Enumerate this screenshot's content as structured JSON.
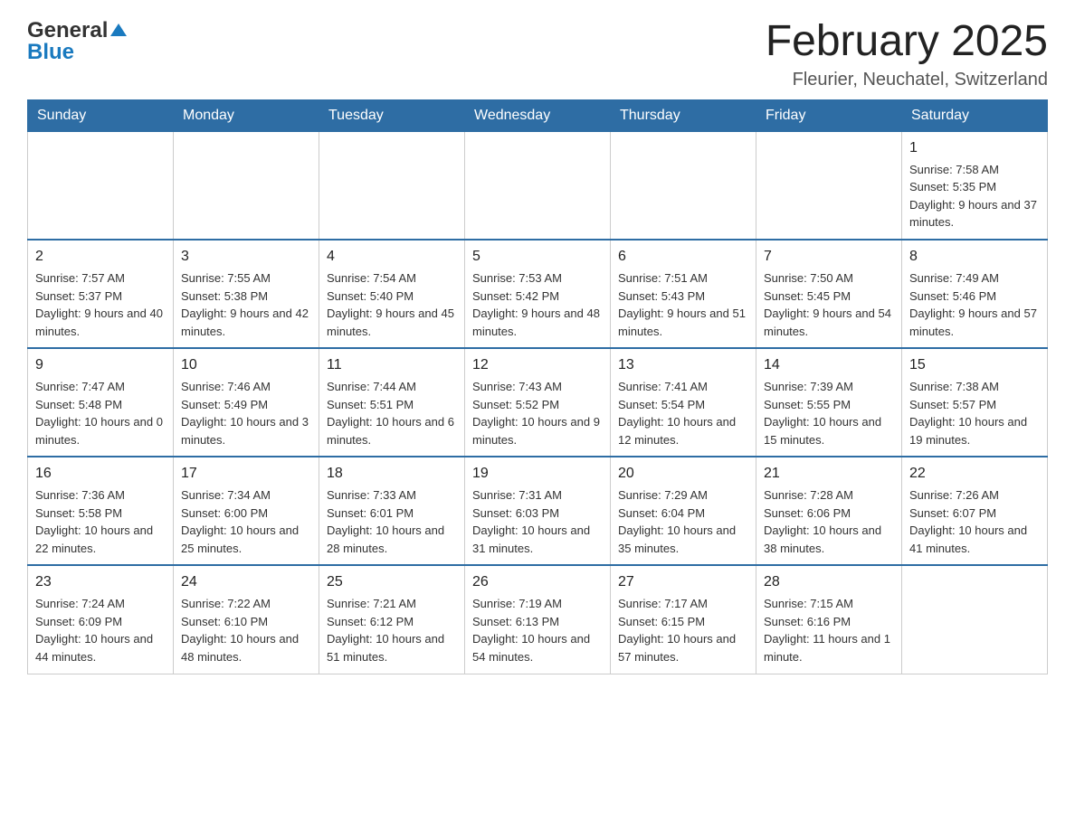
{
  "header": {
    "logo_general": "General",
    "logo_triangle": "▲",
    "logo_blue": "Blue",
    "month_title": "February 2025",
    "location": "Fleurier, Neuchatel, Switzerland"
  },
  "days_of_week": [
    "Sunday",
    "Monday",
    "Tuesday",
    "Wednesday",
    "Thursday",
    "Friday",
    "Saturday"
  ],
  "weeks": [
    [
      {
        "day": "",
        "info": ""
      },
      {
        "day": "",
        "info": ""
      },
      {
        "day": "",
        "info": ""
      },
      {
        "day": "",
        "info": ""
      },
      {
        "day": "",
        "info": ""
      },
      {
        "day": "",
        "info": ""
      },
      {
        "day": "1",
        "info": "Sunrise: 7:58 AM\nSunset: 5:35 PM\nDaylight: 9 hours and 37 minutes."
      }
    ],
    [
      {
        "day": "2",
        "info": "Sunrise: 7:57 AM\nSunset: 5:37 PM\nDaylight: 9 hours and 40 minutes."
      },
      {
        "day": "3",
        "info": "Sunrise: 7:55 AM\nSunset: 5:38 PM\nDaylight: 9 hours and 42 minutes."
      },
      {
        "day": "4",
        "info": "Sunrise: 7:54 AM\nSunset: 5:40 PM\nDaylight: 9 hours and 45 minutes."
      },
      {
        "day": "5",
        "info": "Sunrise: 7:53 AM\nSunset: 5:42 PM\nDaylight: 9 hours and 48 minutes."
      },
      {
        "day": "6",
        "info": "Sunrise: 7:51 AM\nSunset: 5:43 PM\nDaylight: 9 hours and 51 minutes."
      },
      {
        "day": "7",
        "info": "Sunrise: 7:50 AM\nSunset: 5:45 PM\nDaylight: 9 hours and 54 minutes."
      },
      {
        "day": "8",
        "info": "Sunrise: 7:49 AM\nSunset: 5:46 PM\nDaylight: 9 hours and 57 minutes."
      }
    ],
    [
      {
        "day": "9",
        "info": "Sunrise: 7:47 AM\nSunset: 5:48 PM\nDaylight: 10 hours and 0 minutes."
      },
      {
        "day": "10",
        "info": "Sunrise: 7:46 AM\nSunset: 5:49 PM\nDaylight: 10 hours and 3 minutes."
      },
      {
        "day": "11",
        "info": "Sunrise: 7:44 AM\nSunset: 5:51 PM\nDaylight: 10 hours and 6 minutes."
      },
      {
        "day": "12",
        "info": "Sunrise: 7:43 AM\nSunset: 5:52 PM\nDaylight: 10 hours and 9 minutes."
      },
      {
        "day": "13",
        "info": "Sunrise: 7:41 AM\nSunset: 5:54 PM\nDaylight: 10 hours and 12 minutes."
      },
      {
        "day": "14",
        "info": "Sunrise: 7:39 AM\nSunset: 5:55 PM\nDaylight: 10 hours and 15 minutes."
      },
      {
        "day": "15",
        "info": "Sunrise: 7:38 AM\nSunset: 5:57 PM\nDaylight: 10 hours and 19 minutes."
      }
    ],
    [
      {
        "day": "16",
        "info": "Sunrise: 7:36 AM\nSunset: 5:58 PM\nDaylight: 10 hours and 22 minutes."
      },
      {
        "day": "17",
        "info": "Sunrise: 7:34 AM\nSunset: 6:00 PM\nDaylight: 10 hours and 25 minutes."
      },
      {
        "day": "18",
        "info": "Sunrise: 7:33 AM\nSunset: 6:01 PM\nDaylight: 10 hours and 28 minutes."
      },
      {
        "day": "19",
        "info": "Sunrise: 7:31 AM\nSunset: 6:03 PM\nDaylight: 10 hours and 31 minutes."
      },
      {
        "day": "20",
        "info": "Sunrise: 7:29 AM\nSunset: 6:04 PM\nDaylight: 10 hours and 35 minutes."
      },
      {
        "day": "21",
        "info": "Sunrise: 7:28 AM\nSunset: 6:06 PM\nDaylight: 10 hours and 38 minutes."
      },
      {
        "day": "22",
        "info": "Sunrise: 7:26 AM\nSunset: 6:07 PM\nDaylight: 10 hours and 41 minutes."
      }
    ],
    [
      {
        "day": "23",
        "info": "Sunrise: 7:24 AM\nSunset: 6:09 PM\nDaylight: 10 hours and 44 minutes."
      },
      {
        "day": "24",
        "info": "Sunrise: 7:22 AM\nSunset: 6:10 PM\nDaylight: 10 hours and 48 minutes."
      },
      {
        "day": "25",
        "info": "Sunrise: 7:21 AM\nSunset: 6:12 PM\nDaylight: 10 hours and 51 minutes."
      },
      {
        "day": "26",
        "info": "Sunrise: 7:19 AM\nSunset: 6:13 PM\nDaylight: 10 hours and 54 minutes."
      },
      {
        "day": "27",
        "info": "Sunrise: 7:17 AM\nSunset: 6:15 PM\nDaylight: 10 hours and 57 minutes."
      },
      {
        "day": "28",
        "info": "Sunrise: 7:15 AM\nSunset: 6:16 PM\nDaylight: 11 hours and 1 minute."
      },
      {
        "day": "",
        "info": ""
      }
    ]
  ]
}
